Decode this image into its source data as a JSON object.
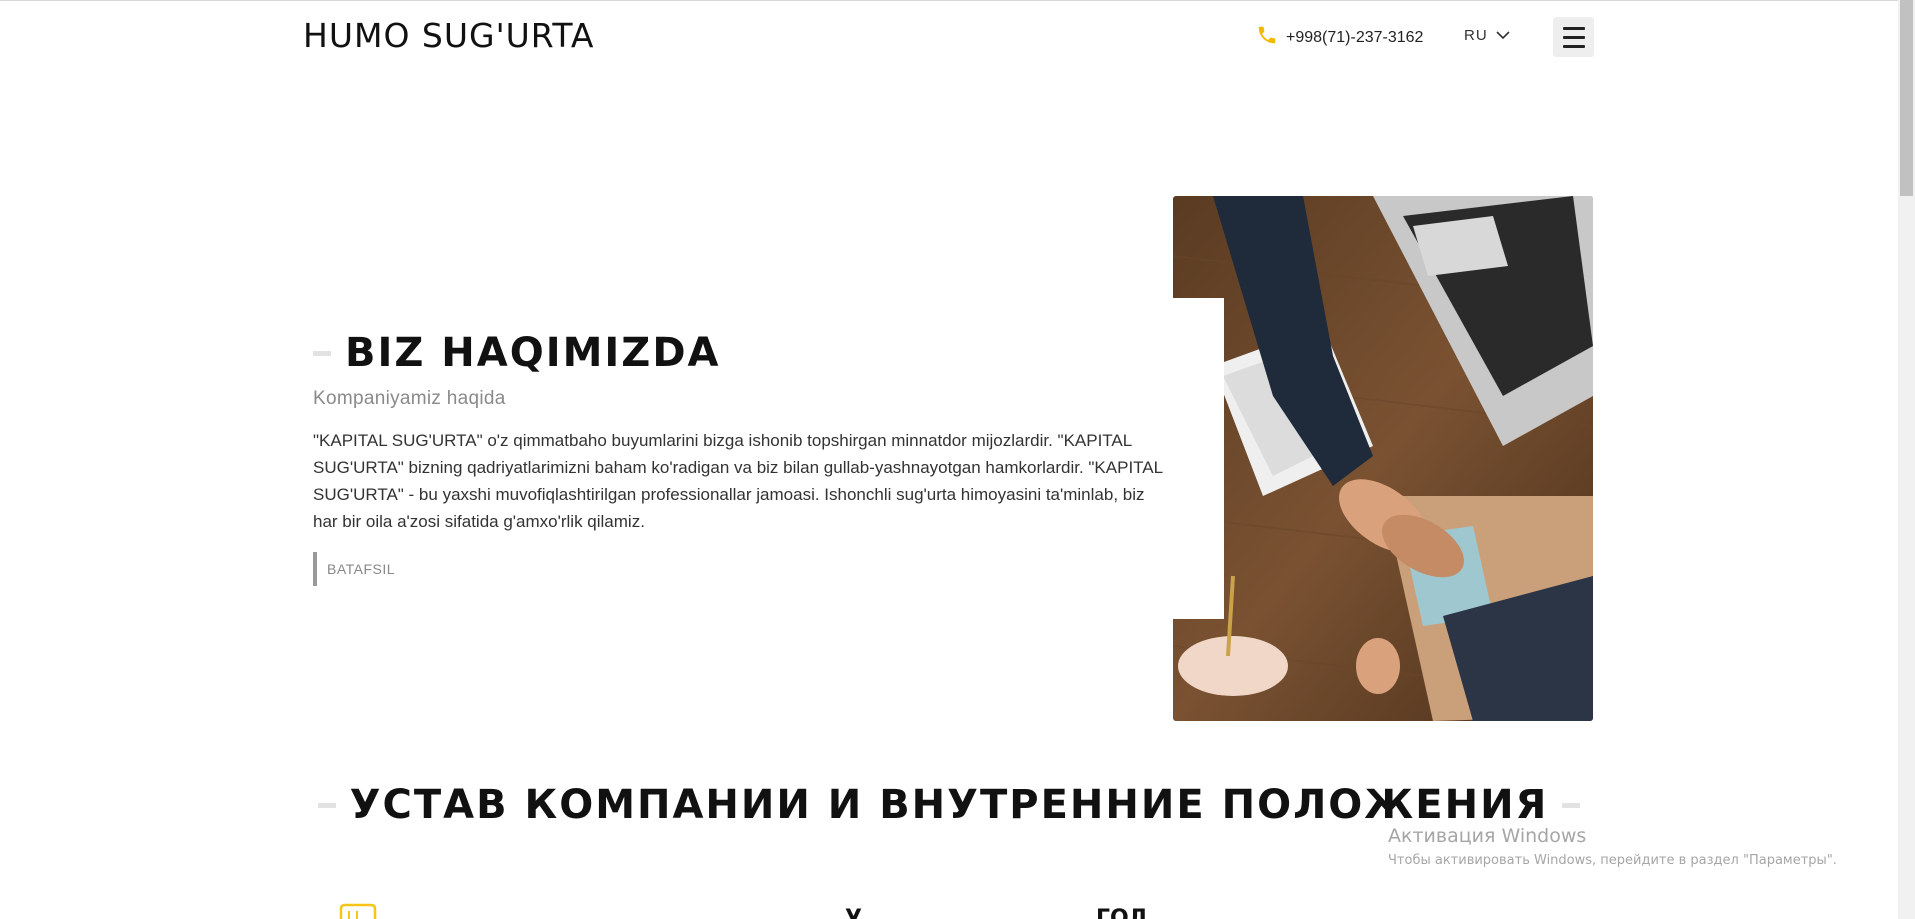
{
  "header": {
    "logo": "HUMO SUG'URTA",
    "phone": "+998(71)-237-3162",
    "language": "RU"
  },
  "about": {
    "title": "BIZ HAQIMIZDA",
    "subtitle": "Kompaniyamiz haqida",
    "text": "\"KAPITAL SUG'URTA\" o'z qimmatbaho buyumlarini bizga ishonib topshirgan minnatdor mijozlardir. \"KAPITAL SUG'URTA\" bizning qadriyatlarimizni baham ko'radigan va biz bilan gullab-yashnayotgan hamkorlardir. \"KAPITAL SUG'URTA\" - bu yaxshi muvofiqlashtirilgan professionallar jamoasi. Ishonchli sug'urta himoyasini ta'minlab, biz har bir oila a'zosi sifatida g'amxo'rlik qilamiz.",
    "more_label": "BATAFSIL"
  },
  "statute": {
    "title": "УСТАВ КОМПАНИИ И ВНУТРЕННИЕ ПОЛОЖЕНИЯ",
    "partial_1": "У",
    "partial_2": "ГОД"
  },
  "watermark": {
    "title": "Активация Windows",
    "subtitle": "Чтобы активировать Windows, перейдите в раздел \"Параметры\"."
  },
  "icons": {
    "phone": "phone-icon",
    "chevron": "chevron-down-icon",
    "menu": "hamburger-menu-icon",
    "document": "document-icon"
  },
  "colors": {
    "accent_yellow": "#f5c518",
    "text_dark": "#111111",
    "text_muted": "#8a8a8a"
  }
}
